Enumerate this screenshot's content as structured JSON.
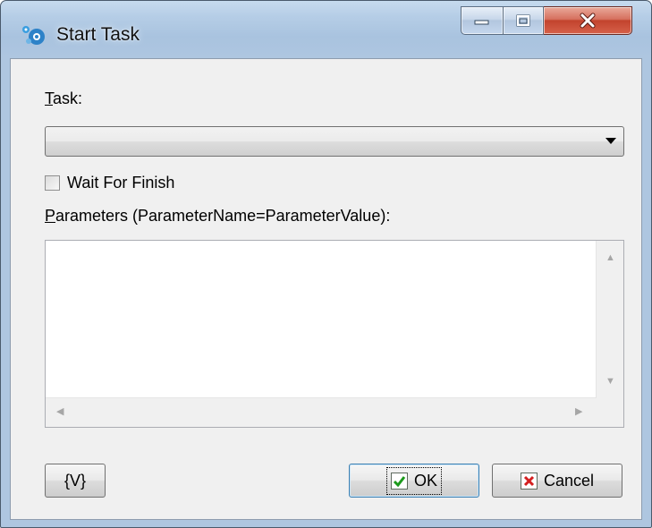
{
  "window": {
    "title": "Start Task",
    "minimize_label": "—",
    "maximize_label": "□",
    "close_label": "X"
  },
  "task": {
    "label_access_key": "T",
    "label_rest": "ask:",
    "selected_value": ""
  },
  "wait_for_finish": {
    "label": "Wait For Finish",
    "checked": false
  },
  "parameters": {
    "label_access_key": "P",
    "label_rest": "arameters (ParameterName=ParameterValue):",
    "value": ""
  },
  "buttons": {
    "variables_label": "{V}",
    "ok_label": "OK",
    "cancel_label": "Cancel"
  },
  "colors": {
    "ok_check": "#1c9a1c",
    "cancel_x": "#d42020",
    "close_button": "#c2432d"
  },
  "icons": {
    "app": "start-task-icon",
    "ok": "check-icon",
    "cancel": "x-icon"
  }
}
